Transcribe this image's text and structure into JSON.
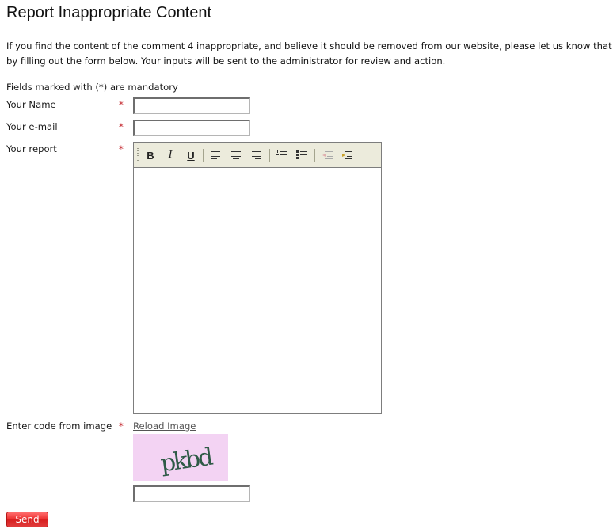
{
  "page": {
    "title": "Report Inappropriate Content",
    "intro": "If you find the content of the comment 4 inappropriate, and believe it should be removed from our website, please let us know that by filling out the form below. Your inputs will be sent to the administrator for review and action.",
    "mandatory_note": "Fields marked with (*) are mandatory"
  },
  "form": {
    "required_mark": "*",
    "name": {
      "label": "Your Name",
      "value": ""
    },
    "email": {
      "label": "Your e-mail",
      "value": ""
    },
    "report": {
      "label": "Your report",
      "value": ""
    },
    "captcha": {
      "label": "Enter code from image",
      "reload_label": "Reload Image",
      "image_text": "pkbd",
      "value": ""
    },
    "send_label": "Send"
  },
  "toolbar": {
    "bold": "B",
    "italic": "I",
    "underline": "U",
    "icons": [
      "bold-icon",
      "italic-icon",
      "underline-icon",
      "align-left-icon",
      "align-center-icon",
      "align-right-icon",
      "ordered-list-icon",
      "unordered-list-icon",
      "outdent-icon",
      "indent-icon"
    ]
  },
  "colors": {
    "required": "#c0181f",
    "toolbar_bg": "#ecebdc",
    "captcha_bg": "#f3d3f3",
    "captcha_text": "#2e5a46",
    "send_button": "#e83030"
  }
}
